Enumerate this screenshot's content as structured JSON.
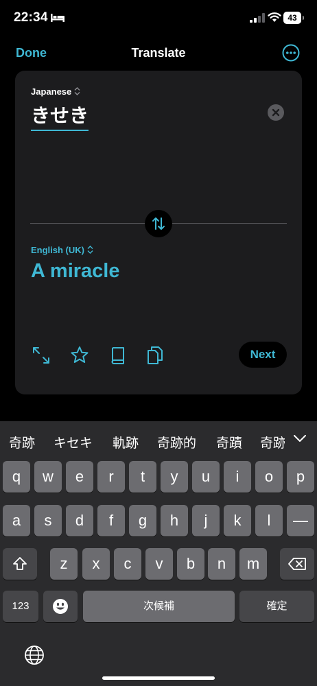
{
  "status_bar": {
    "time": "22:34",
    "battery": "43",
    "icons": [
      "bed-icon",
      "cellular-signal-icon",
      "wifi-icon",
      "battery-icon"
    ]
  },
  "nav": {
    "done_label": "Done",
    "title": "Translate",
    "more_icon": "ellipsis-circle-icon"
  },
  "translation": {
    "source_language": "Japanese",
    "source_text": "きせき",
    "target_language": "English (UK)",
    "target_text": "A miracle",
    "next_label": "Next",
    "tools": [
      "expand-icon",
      "star-icon",
      "book-icon",
      "copy-icon"
    ]
  },
  "keyboard": {
    "candidates": [
      "奇跡",
      "キセキ",
      "軌跡",
      "奇跡的",
      "奇蹟",
      "奇跡"
    ],
    "row1": [
      "q",
      "w",
      "e",
      "r",
      "t",
      "y",
      "u",
      "i",
      "o",
      "p"
    ],
    "row2": [
      "a",
      "s",
      "d",
      "f",
      "g",
      "h",
      "j",
      "k",
      "l",
      "—"
    ],
    "row3": [
      "z",
      "x",
      "c",
      "v",
      "b",
      "n",
      "m"
    ],
    "numbers_label": "123",
    "space_label": "次候補",
    "confirm_label": "確定"
  },
  "colors": {
    "accent": "#3fb8d4",
    "background": "#000000",
    "card": "#1c1c1e",
    "keyboard": "#2b2b2d",
    "key": "#6c6c70",
    "key_dark": "#464649"
  }
}
